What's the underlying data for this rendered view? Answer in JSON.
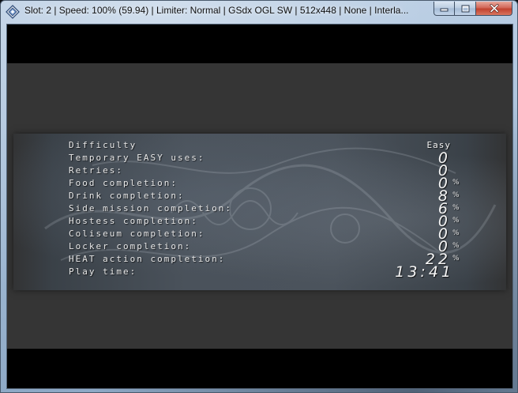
{
  "window": {
    "title": "Slot: 2 | Speed: 100% (59.94) | Limiter: Normal | GSdx OGL SW | 512x448 | None | Interla...",
    "app_icon": "pcsx2-diamond-icon",
    "buttons": {
      "minimize_icon": "minimize-icon",
      "maximize_icon": "maximize-icon",
      "close_icon": "close-icon"
    }
  },
  "stats": {
    "rows": [
      {
        "label": "Difficulty",
        "value": "Easy",
        "unit": ""
      },
      {
        "label": "Temporary EASY uses:",
        "value": "0",
        "unit": ""
      },
      {
        "label": "Retries:",
        "value": "0",
        "unit": ""
      },
      {
        "label": "Food completion:",
        "value": "0",
        "unit": "%"
      },
      {
        "label": "Drink completion:",
        "value": "8",
        "unit": "%"
      },
      {
        "label": "Side mission completion:",
        "value": "6",
        "unit": "%"
      },
      {
        "label": "Hostess completion:",
        "value": "0",
        "unit": "%"
      },
      {
        "label": "Coliseum completion:",
        "value": "0",
        "unit": "%"
      },
      {
        "label": "Locker completion:",
        "value": "0",
        "unit": "%"
      },
      {
        "label": "HEAT action completion:",
        "value": "22",
        "unit": "%"
      },
      {
        "label": "Play time:",
        "value": "13:41",
        "unit": ""
      }
    ]
  },
  "colors": {
    "letterbox": "#000000",
    "game_background": "#353535",
    "text": "#e8e8e8"
  }
}
